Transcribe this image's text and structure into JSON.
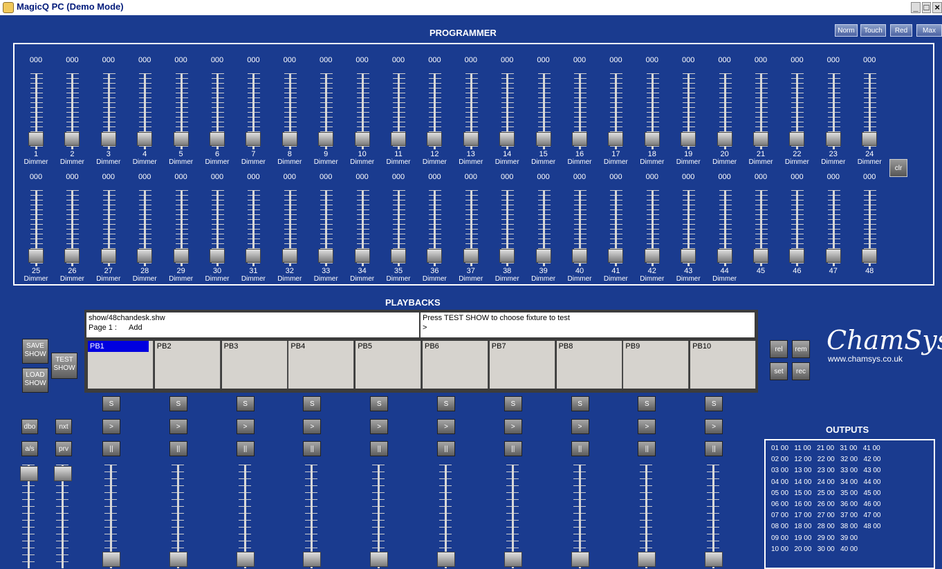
{
  "window": {
    "title": "MagicQ PC (Demo Mode)",
    "controls": [
      "_",
      "□",
      "×"
    ]
  },
  "modes": [
    {
      "label": "Norm"
    },
    {
      "label": "Touch"
    },
    {
      "label": "Red"
    },
    {
      "label": "Max"
    }
  ],
  "programmer": {
    "title": "PROGRAMMER",
    "clear_label": "clr",
    "row1": [
      {
        "value": "000",
        "num": "1",
        "name": "Dimmer"
      },
      {
        "value": "000",
        "num": "2",
        "name": "Dimmer"
      },
      {
        "value": "000",
        "num": "3",
        "name": "Dimmer"
      },
      {
        "value": "000",
        "num": "4",
        "name": "Dimmer"
      },
      {
        "value": "000",
        "num": "5",
        "name": "Dimmer"
      },
      {
        "value": "000",
        "num": "6",
        "name": "Dimmer"
      },
      {
        "value": "000",
        "num": "7",
        "name": "Dimmer"
      },
      {
        "value": "000",
        "num": "8",
        "name": "Dimmer"
      },
      {
        "value": "000",
        "num": "9",
        "name": "Dimmer"
      },
      {
        "value": "000",
        "num": "10",
        "name": "Dimmer"
      },
      {
        "value": "000",
        "num": "11",
        "name": "Dimmer"
      },
      {
        "value": "000",
        "num": "12",
        "name": "Dimmer"
      },
      {
        "value": "000",
        "num": "13",
        "name": "Dimmer"
      },
      {
        "value": "000",
        "num": "14",
        "name": "Dimmer"
      },
      {
        "value": "000",
        "num": "15",
        "name": "Dimmer"
      },
      {
        "value": "000",
        "num": "16",
        "name": "Dimmer"
      },
      {
        "value": "000",
        "num": "17",
        "name": "Dimmer"
      },
      {
        "value": "000",
        "num": "18",
        "name": "Dimmer"
      },
      {
        "value": "000",
        "num": "19",
        "name": "Dimmer"
      },
      {
        "value": "000",
        "num": "20",
        "name": "Dimmer"
      },
      {
        "value": "000",
        "num": "21",
        "name": "Dimmer"
      },
      {
        "value": "000",
        "num": "22",
        "name": "Dimmer"
      },
      {
        "value": "000",
        "num": "23",
        "name": "Dimmer"
      },
      {
        "value": "000",
        "num": "24",
        "name": "Dimmer"
      }
    ],
    "row2": [
      {
        "value": "000",
        "num": "25",
        "name": "Dimmer"
      },
      {
        "value": "000",
        "num": "26",
        "name": "Dimmer"
      },
      {
        "value": "000",
        "num": "27",
        "name": "Dimmer"
      },
      {
        "value": "000",
        "num": "28",
        "name": "Dimmer"
      },
      {
        "value": "000",
        "num": "29",
        "name": "Dimmer"
      },
      {
        "value": "000",
        "num": "30",
        "name": "Dimmer"
      },
      {
        "value": "000",
        "num": "31",
        "name": "Dimmer"
      },
      {
        "value": "000",
        "num": "32",
        "name": "Dimmer"
      },
      {
        "value": "000",
        "num": "33",
        "name": "Dimmer"
      },
      {
        "value": "000",
        "num": "34",
        "name": "Dimmer"
      },
      {
        "value": "000",
        "num": "35",
        "name": "Dimmer"
      },
      {
        "value": "000",
        "num": "36",
        "name": "Dimmer"
      },
      {
        "value": "000",
        "num": "37",
        "name": "Dimmer"
      },
      {
        "value": "000",
        "num": "38",
        "name": "Dimmer"
      },
      {
        "value": "000",
        "num": "39",
        "name": "Dimmer"
      },
      {
        "value": "000",
        "num": "40",
        "name": "Dimmer"
      },
      {
        "value": "000",
        "num": "41",
        "name": "Dimmer"
      },
      {
        "value": "000",
        "num": "42",
        "name": "Dimmer"
      },
      {
        "value": "000",
        "num": "43",
        "name": "Dimmer"
      },
      {
        "value": "000",
        "num": "44",
        "name": "Dimmer"
      },
      {
        "value": "000",
        "num": "45",
        "name": ""
      },
      {
        "value": "000",
        "num": "46",
        "name": ""
      },
      {
        "value": "000",
        "num": "47",
        "name": ""
      },
      {
        "value": "000",
        "num": "48",
        "name": ""
      }
    ]
  },
  "playbacks": {
    "title": "PLAYBACKS",
    "show_file": "show/48chandesk.shw",
    "page_label": "Page 1 :",
    "page_mode": "Add",
    "prompt_message": "Press TEST SHOW to choose fixture to test",
    "prompt_cursor": ">",
    "buttons": {
      "save_show": "SAVE SHOW",
      "load_show": "LOAD SHOW",
      "test_show": "TEST SHOW",
      "dbo": "dbo",
      "nxt": "nxt",
      "as": "a/s",
      "prv": "prv",
      "rel": "rel",
      "rem": "rem",
      "set": "set",
      "rec": "rec"
    },
    "items": [
      {
        "label": "PB1",
        "s": "S",
        "go": ">",
        "pause": "||"
      },
      {
        "label": "PB2",
        "s": "S",
        "go": ">",
        "pause": "||"
      },
      {
        "label": "PB3",
        "s": "S",
        "go": ">",
        "pause": "||"
      },
      {
        "label": "PB4",
        "s": "S",
        "go": ">",
        "pause": "||"
      },
      {
        "label": "PB5",
        "s": "S",
        "go": ">",
        "pause": "||"
      },
      {
        "label": "PB6",
        "s": "S",
        "go": ">",
        "pause": "||"
      },
      {
        "label": "PB7",
        "s": "S",
        "go": ">",
        "pause": "||"
      },
      {
        "label": "PB8",
        "s": "S",
        "go": ">",
        "pause": "||"
      },
      {
        "label": "PB9",
        "s": "S",
        "go": ">",
        "pause": "||"
      },
      {
        "label": "PB10",
        "s": "S",
        "go": ">",
        "pause": "||"
      }
    ],
    "selected_index": 0
  },
  "brand": {
    "logo": "ChamSys",
    "url": "www.chamsys.co.uk"
  },
  "outputs": {
    "title": "OUTPUTS",
    "rows": [
      "01 00   11 00   21 00   31 00   41 00",
      "02 00   12 00   22 00   32 00   42 00",
      "03 00   13 00   23 00   33 00   43 00",
      "04 00   14 00   24 00   34 00   44 00",
      "05 00   15 00   25 00   35 00   45 00",
      "06 00   16 00   26 00   36 00   46 00",
      "07 00   17 00   27 00   37 00   47 00",
      "08 00   18 00   28 00   38 00   48 00",
      "09 00   19 00   29 00   39 00",
      "10 00   20 00   30 00   40 00"
    ]
  },
  "colors": {
    "background": "#1a3b8f",
    "selected": "#0000e0",
    "panel": "#d6d3ce"
  }
}
